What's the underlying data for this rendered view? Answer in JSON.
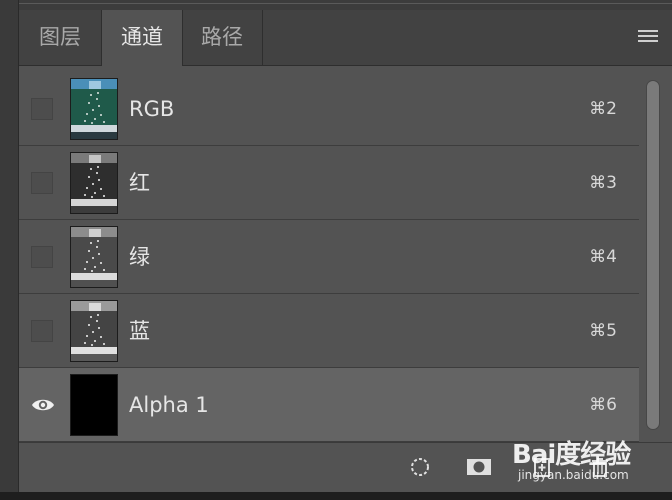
{
  "tabs": [
    {
      "label": "图层",
      "active": false
    },
    {
      "label": "通道",
      "active": true
    },
    {
      "label": "路径",
      "active": false
    }
  ],
  "panel_menu_icon": "hamburger-menu-icon",
  "channels": [
    {
      "name": "RGB",
      "shortcut": "⌘2",
      "visible": false,
      "thumb": "rgb"
    },
    {
      "name": "红",
      "shortcut": "⌘3",
      "visible": false,
      "thumb": "gray"
    },
    {
      "name": "绿",
      "shortcut": "⌘4",
      "visible": false,
      "thumb": "gray"
    },
    {
      "name": "蓝",
      "shortcut": "⌘5",
      "visible": false,
      "thumb": "gray"
    },
    {
      "name": "Alpha 1",
      "shortcut": "⌘6",
      "visible": true,
      "thumb": "black",
      "selected": true
    }
  ],
  "footer_icons": [
    "load-selection-icon",
    "save-selection-as-channel-icon",
    "new-channel-icon",
    "delete-channel-icon"
  ],
  "watermark": {
    "logo": "Bai度经验",
    "url": "jingyan.baidu.com"
  }
}
